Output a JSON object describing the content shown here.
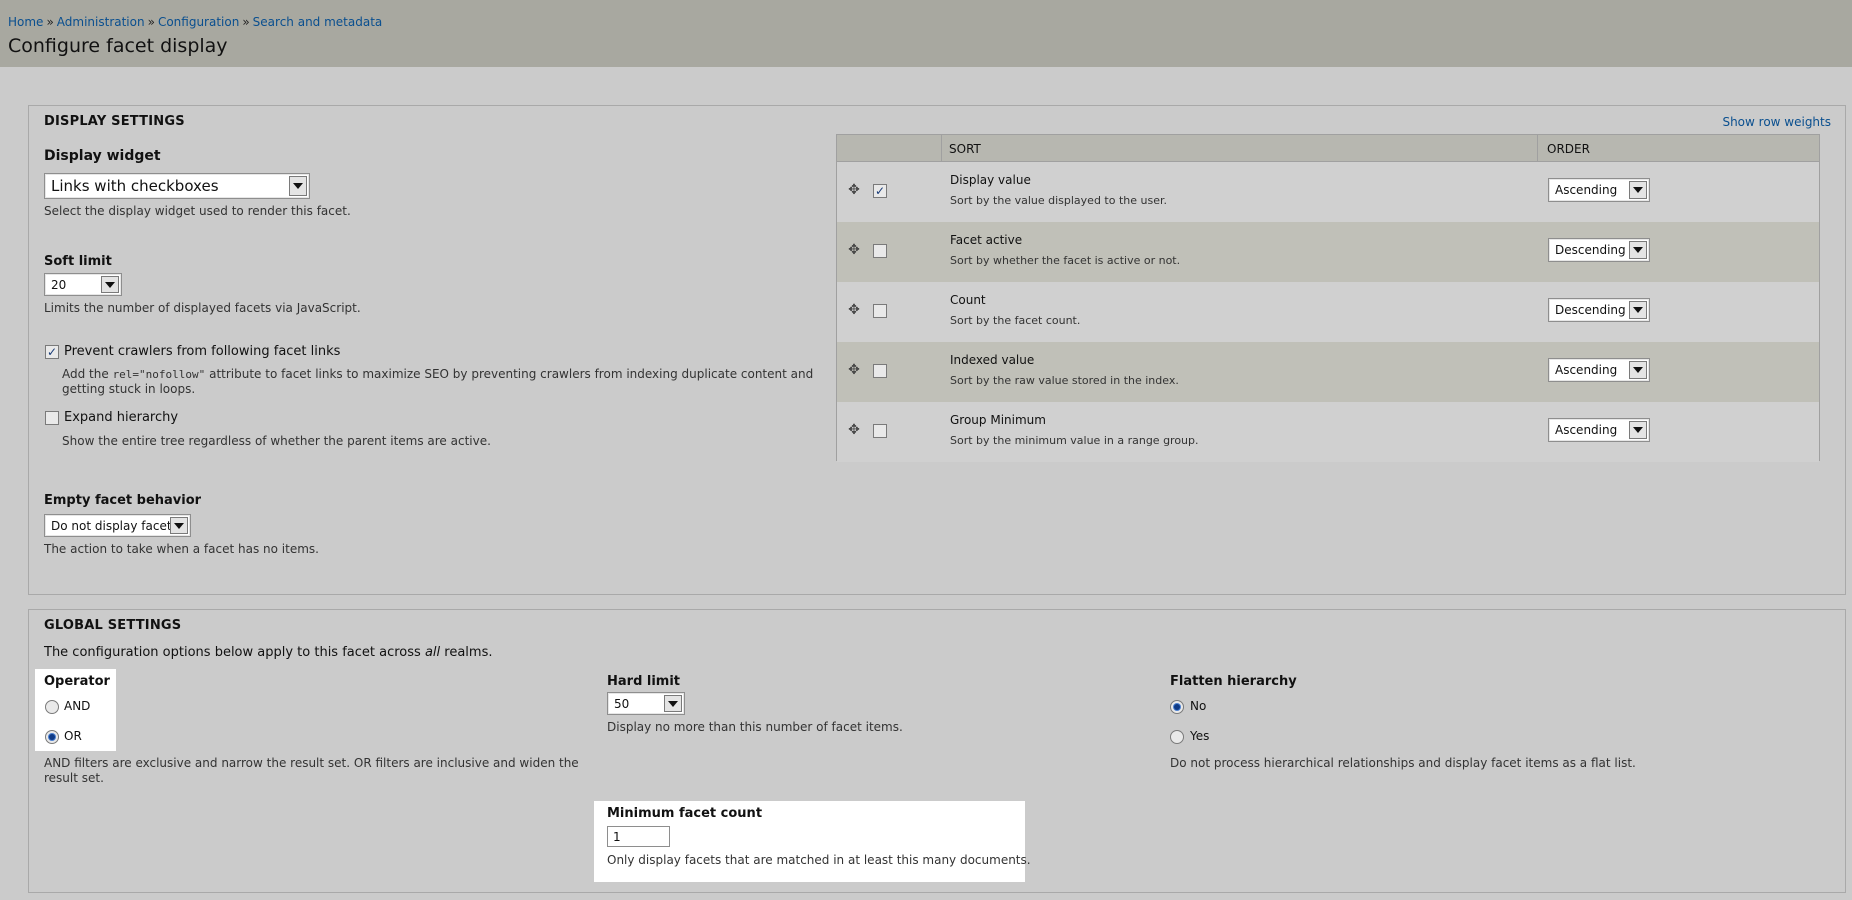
{
  "breadcrumb": {
    "items": [
      "Home",
      "Administration",
      "Configuration",
      "Search and metadata"
    ],
    "separator": "»"
  },
  "page_title": "Configure facet display",
  "display_settings": {
    "legend": "DISPLAY SETTINGS",
    "show_row_weights": "Show row weights",
    "display_widget": {
      "label": "Display widget",
      "value": "Links with checkboxes",
      "description": "Select the display widget used to render this facet."
    },
    "soft_limit": {
      "label": "Soft limit",
      "value": "20",
      "description": "Limits the number of displayed facets via JavaScript."
    },
    "prevent_crawlers": {
      "label": "Prevent crawlers from following facet links",
      "checked": true,
      "desc_before": "Add the ",
      "desc_code": "rel=\"nofollow\"",
      "desc_after": " attribute to facet links to maximize SEO by preventing crawlers from indexing duplicate content and",
      "desc_line2": "getting stuck in loops."
    },
    "expand_hierarchy": {
      "label": "Expand hierarchy",
      "checked": false,
      "description": "Show the entire tree regardless of whether the parent items are active."
    },
    "empty_facet": {
      "label": "Empty facet behavior",
      "value": "Do not display facet",
      "description": "The action to take when a facet has no items."
    },
    "sort_table": {
      "headers": {
        "sort": "SORT",
        "order": "ORDER"
      },
      "rows": [
        {
          "title": "Display value",
          "description": "Sort by the value displayed to the user.",
          "enabled": true,
          "order": "Ascending"
        },
        {
          "title": "Facet active",
          "description": "Sort by whether the facet is active or not.",
          "enabled": false,
          "order": "Descending"
        },
        {
          "title": "Count",
          "description": "Sort by the facet count.",
          "enabled": false,
          "order": "Descending"
        },
        {
          "title": "Indexed value",
          "description": "Sort by the raw value stored in the index.",
          "enabled": false,
          "order": "Ascending"
        },
        {
          "title": "Group Minimum",
          "description": "Sort by the minimum value in a range group.",
          "enabled": false,
          "order": "Ascending"
        }
      ]
    }
  },
  "global_settings": {
    "legend": "GLOBAL SETTINGS",
    "intro_before": "The configuration options below apply to this facet across ",
    "intro_em": "all",
    "intro_after": " realms.",
    "operator": {
      "label": "Operator",
      "options": [
        "AND",
        "OR"
      ],
      "selected": "OR",
      "desc_line1": "AND filters are exclusive and narrow the result set. OR filters are inclusive and widen the",
      "desc_line2": "result set."
    },
    "hard_limit": {
      "label": "Hard limit",
      "value": "50",
      "description": "Display no more than this number of facet items."
    },
    "flatten_hierarchy": {
      "label": "Flatten hierarchy",
      "options": [
        "No",
        "Yes"
      ],
      "selected": "No",
      "description": "Do not process hierarchical relationships and display facet items as a flat list."
    },
    "min_facet_count": {
      "label": "Minimum facet count",
      "value": "1",
      "description": "Only display facets that are matched in at least this many documents."
    }
  }
}
